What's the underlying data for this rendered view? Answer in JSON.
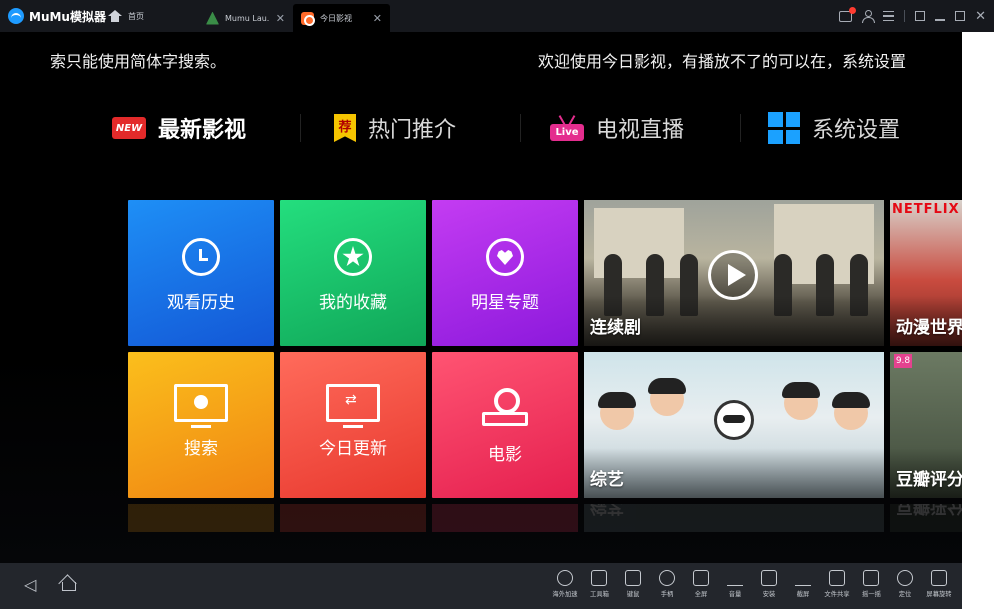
{
  "window": {
    "brand": "MuMu模拟器",
    "home_tab": "首页",
    "tabs": [
      {
        "label": "Mumu Lau...",
        "active": false
      },
      {
        "label": "今日影视",
        "active": true
      }
    ]
  },
  "marquee": {
    "left": "索只能使用简体字搜索。",
    "right": "欢迎使用今日影视，有播放不了的可以在，系统设置"
  },
  "nav": {
    "items": [
      {
        "label": "最新影视",
        "badge": "NEW",
        "active": true
      },
      {
        "label": "热门推介",
        "badge": "荐",
        "active": false
      },
      {
        "label": "电视直播",
        "badge": "Live",
        "active": false
      },
      {
        "label": "系统设置",
        "badge": "",
        "active": false
      }
    ]
  },
  "tiles": [
    {
      "label": "观看历史",
      "icon": "clock-icon",
      "color": "#1e8ff6"
    },
    {
      "label": "我的收藏",
      "icon": "star-icon",
      "color": "#24de7e"
    },
    {
      "label": "明星专题",
      "icon": "heart-icon",
      "color": "#c43cf2"
    },
    {
      "label": "搜索",
      "icon": "search-monitor-icon",
      "color": "#fbbf1c"
    },
    {
      "label": "今日更新",
      "icon": "refresh-monitor-icon",
      "color": "#ff6b5b"
    },
    {
      "label": "电影",
      "icon": "film-reel-icon",
      "color": "#ff5472"
    }
  ],
  "banners": {
    "drama": "连续剧",
    "variety": "综艺",
    "anime": "动漫世界",
    "douban": "豆瓣评分",
    "anime_brand": "NETFLIX",
    "douban_score": "9.8"
  },
  "android_toolbar": [
    {
      "label": "海外加速",
      "icon": "accelerate-icon"
    },
    {
      "label": "工具箱",
      "icon": "toolbox-icon"
    },
    {
      "label": "键鼠",
      "icon": "keyboard-icon"
    },
    {
      "label": "手柄",
      "icon": "gamepad-icon"
    },
    {
      "label": "全屏",
      "icon": "fullscreen-icon"
    },
    {
      "label": "音量",
      "icon": "volume-icon"
    },
    {
      "label": "安装",
      "icon": "apk-install-icon"
    },
    {
      "label": "截屏",
      "icon": "crop-icon"
    },
    {
      "label": "文件共享",
      "icon": "folder-icon"
    },
    {
      "label": "摇一摇",
      "icon": "shake-icon"
    },
    {
      "label": "定位",
      "icon": "location-icon"
    },
    {
      "label": "屏幕旋转",
      "icon": "rotate-icon"
    }
  ]
}
